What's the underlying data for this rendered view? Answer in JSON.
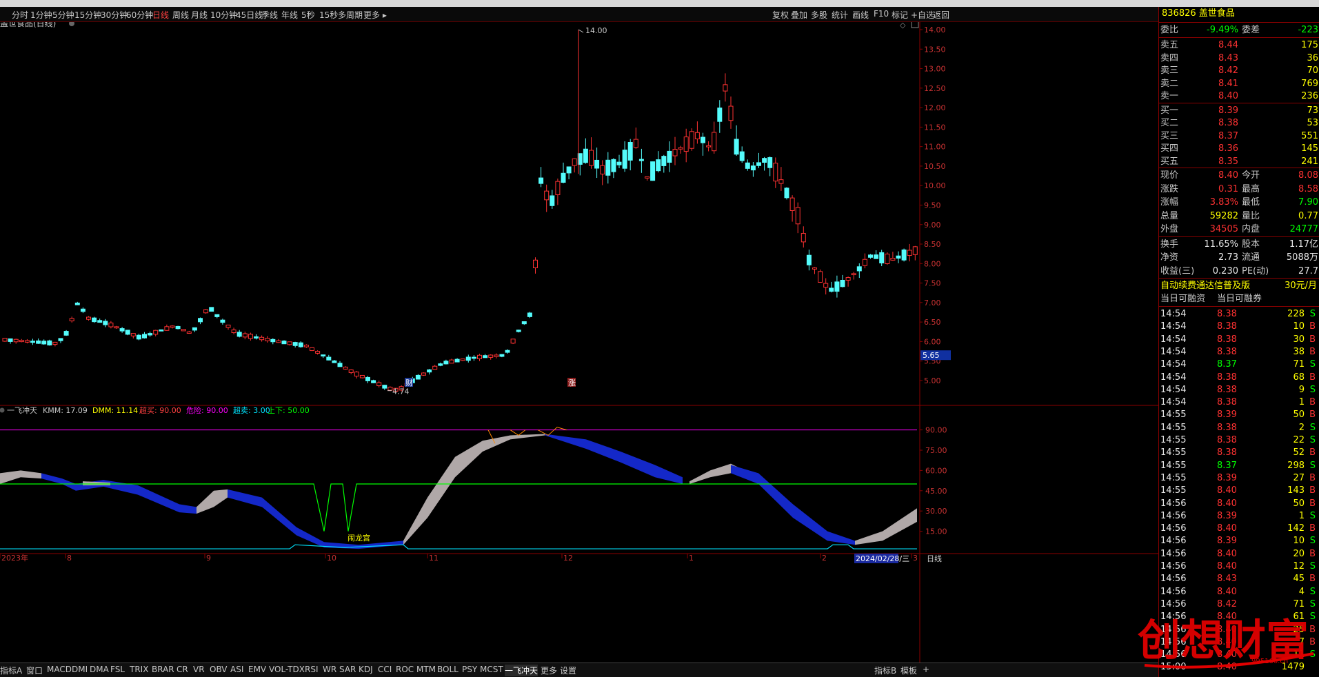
{
  "periods": [
    "分时",
    "1分钟",
    "5分钟",
    "15分钟",
    "30分钟",
    "60分钟",
    "日线",
    "周线",
    "月线",
    "10分钟",
    "45日线",
    "季线",
    "年线",
    "5秒",
    "15秒",
    "多周期",
    "更多 ▸"
  ],
  "active_period": "日线",
  "toolbar_right": [
    "复权",
    "叠加",
    "多股",
    "统计",
    "画线",
    "F10",
    "标记",
    "+自选",
    "返回"
  ],
  "chart_title": "盖世食品(日线)",
  "price_axis": [
    "14.00",
    "13.50",
    "13.00",
    "12.50",
    "12.00",
    "11.50",
    "11.00",
    "10.50",
    "10.00",
    "9.50",
    "9.00",
    "8.50",
    "8.00",
    "7.50",
    "7.00",
    "6.50",
    "6.00",
    "5.50",
    "5.00"
  ],
  "price_marker": "5.65",
  "high_label": "14.00",
  "low_label": "4.74",
  "event_labels": {
    "cai": "财",
    "zhang": "涨"
  },
  "indicator_legend": {
    "name": "一飞冲天",
    "kmm": "KMM: 17.09",
    "dmm": "DMM: 11.14",
    "chaomai": "超买: 90.00",
    "weixian": "危险: 90.00",
    "chaomai2": "超卖: 3.00",
    "shangxia": "上下: 50.00"
  },
  "indicator_axis": [
    "90.00",
    "75.00",
    "60.00",
    "45.00",
    "30.00",
    "15.00"
  ],
  "indicator_annotation": "闹龙宫",
  "time_axis": [
    "2023年",
    "8",
    "9",
    "10",
    "11",
    "12",
    "1",
    "2",
    "3"
  ],
  "time_cursor": "2024/02/28/三",
  "timeframe_label": "日线",
  "indicator_tabs": [
    "指标A",
    "窗口",
    "MACD",
    "DMI",
    "DMA",
    "FSL",
    "TRIX",
    "BRAR",
    "CR",
    "VR",
    "OBV",
    "ASI",
    "EMV",
    "VOL-TDX",
    "RSI",
    "WR",
    "SAR",
    "KDJ",
    "CCI",
    "ROC",
    "MTM",
    "BOLL",
    "PSY",
    "MCST",
    "一飞冲天",
    "更多",
    "设置"
  ],
  "indicator_tabs_right": [
    "指标B",
    "模板",
    "+"
  ],
  "quote": {
    "code": "836826",
    "name": "盖世食品",
    "weibi_label": "委比",
    "weibi": "-9.49%",
    "weicha_label": "委差",
    "weicha": "-223",
    "sells": [
      {
        "label": "卖五",
        "price": "8.44",
        "vol": "175"
      },
      {
        "label": "卖四",
        "price": "8.43",
        "vol": "36"
      },
      {
        "label": "卖三",
        "price": "8.42",
        "vol": "70"
      },
      {
        "label": "卖二",
        "price": "8.41",
        "vol": "769"
      },
      {
        "label": "卖一",
        "price": "8.40",
        "vol": "236"
      }
    ],
    "buys": [
      {
        "label": "买一",
        "price": "8.39",
        "vol": "73"
      },
      {
        "label": "买二",
        "price": "8.38",
        "vol": "53"
      },
      {
        "label": "买三",
        "price": "8.37",
        "vol": "551"
      },
      {
        "label": "买四",
        "price": "8.36",
        "vol": "145"
      },
      {
        "label": "买五",
        "price": "8.35",
        "vol": "241"
      }
    ],
    "stats": [
      {
        "l1": "现价",
        "v1": "8.40",
        "l2": "今开",
        "v2": "8.08"
      },
      {
        "l1": "涨跌",
        "v1": "0.31",
        "l2": "最高",
        "v2": "8.58"
      },
      {
        "l1": "涨幅",
        "v1": "3.83%",
        "l2": "最低",
        "v2": "7.90"
      },
      {
        "l1": "总量",
        "v1": "59282",
        "l2": "量比",
        "v2": "0.77"
      },
      {
        "l1": "外盘",
        "v1": "34505",
        "l2": "内盘",
        "v2": "24777"
      }
    ],
    "fundamentals": [
      {
        "l1": "换手",
        "v1": "11.65%",
        "l2": "股本",
        "v2": "1.17亿"
      },
      {
        "l1": "净资",
        "v1": "2.73",
        "l2": "流通",
        "v2": "5088万"
      },
      {
        "l1": "收益(三)",
        "v1": "0.230",
        "l2": "PE(动)",
        "v2": "27.7"
      }
    ],
    "promo": "自动续费通达信普及版",
    "promo_price": "30元/月",
    "margin_left": "当日可融资",
    "margin_right": "当日可融券",
    "ticks": [
      {
        "t": "14:54",
        "p": "8.38",
        "v": "228",
        "s": "S"
      },
      {
        "t": "14:54",
        "p": "8.38",
        "v": "10",
        "s": "B"
      },
      {
        "t": "14:54",
        "p": "8.38",
        "v": "30",
        "s": "B"
      },
      {
        "t": "14:54",
        "p": "8.38",
        "v": "38",
        "s": "B"
      },
      {
        "t": "14:54",
        "p": "8.37",
        "v": "71",
        "s": "S"
      },
      {
        "t": "14:54",
        "p": "8.38",
        "v": "68",
        "s": "B"
      },
      {
        "t": "14:54",
        "p": "8.38",
        "v": "9",
        "s": "S"
      },
      {
        "t": "14:54",
        "p": "8.38",
        "v": "1",
        "s": "B"
      },
      {
        "t": "14:55",
        "p": "8.39",
        "v": "50",
        "s": "B"
      },
      {
        "t": "14:55",
        "p": "8.38",
        "v": "2",
        "s": "S"
      },
      {
        "t": "14:55",
        "p": "8.38",
        "v": "22",
        "s": "S"
      },
      {
        "t": "14:55",
        "p": "8.38",
        "v": "52",
        "s": "B"
      },
      {
        "t": "14:55",
        "p": "8.37",
        "v": "298",
        "s": "S"
      },
      {
        "t": "14:55",
        "p": "8.39",
        "v": "27",
        "s": "B"
      },
      {
        "t": "14:55",
        "p": "8.40",
        "v": "143",
        "s": "B"
      },
      {
        "t": "14:56",
        "p": "8.40",
        "v": "50",
        "s": "B"
      },
      {
        "t": "14:56",
        "p": "8.39",
        "v": "1",
        "s": "S"
      },
      {
        "t": "14:56",
        "p": "8.40",
        "v": "142",
        "s": "B"
      },
      {
        "t": "14:56",
        "p": "8.39",
        "v": "10",
        "s": "S"
      },
      {
        "t": "14:56",
        "p": "8.40",
        "v": "20",
        "s": "B"
      },
      {
        "t": "14:56",
        "p": "8.40",
        "v": "12",
        "s": "S"
      },
      {
        "t": "14:56",
        "p": "8.43",
        "v": "45",
        "s": "B"
      },
      {
        "t": "14:56",
        "p": "8.40",
        "v": "4",
        "s": "S"
      },
      {
        "t": "14:56",
        "p": "8.42",
        "v": "71",
        "s": "S"
      },
      {
        "t": "14:56",
        "p": "8.40",
        "v": "61",
        "s": "S"
      },
      {
        "t": "14:56",
        "p": "8.40",
        "v": "25",
        "s": "B"
      },
      {
        "t": "14:56",
        "p": "8.40",
        "v": "7",
        "s": "B"
      },
      {
        "t": "14:56",
        "p": "8.40",
        "v": "11",
        "s": "S"
      },
      {
        "t": "15:00",
        "p": "8.40",
        "v": "1479",
        "s": ""
      }
    ]
  },
  "watermark": "创想财富",
  "watermark_url": "995166.cn",
  "colors": {
    "up": "#ff3232",
    "down": "#54fcfc",
    "grid": "#8b0000",
    "yellow": "#ffff00",
    "green": "#00ff00",
    "magenta": "#ff00ff"
  }
}
